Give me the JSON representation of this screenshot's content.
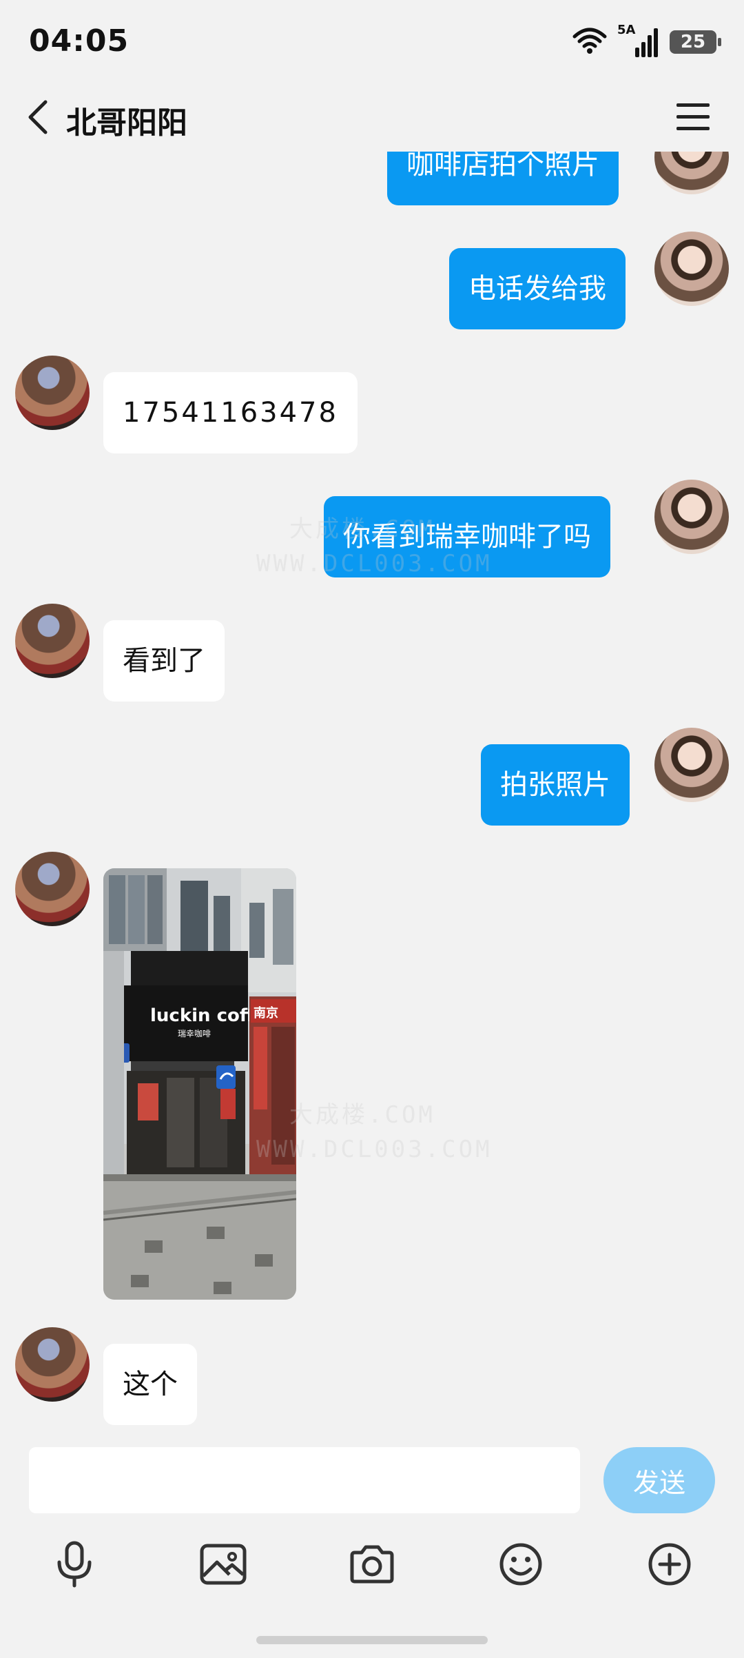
{
  "status_bar": {
    "time": "04:05",
    "network": "5A",
    "battery": "25"
  },
  "header": {
    "title": "北哥阳阳"
  },
  "messages": [
    {
      "side": "out",
      "type": "text",
      "text": "咖啡店拍个照片"
    },
    {
      "side": "out",
      "type": "text",
      "text": "电话发给我"
    },
    {
      "side": "in",
      "type": "text",
      "text": "17541163478"
    },
    {
      "side": "out",
      "type": "text",
      "text": "你看到瑞幸咖啡了吗"
    },
    {
      "side": "in",
      "type": "text",
      "text": "看到了"
    },
    {
      "side": "out",
      "type": "text",
      "text": "拍张照片"
    },
    {
      "side": "in",
      "type": "image",
      "sign_text": "luckin coffee",
      "sign_subtext": "瑞幸咖啡",
      "side_sign": "南京"
    },
    {
      "side": "in",
      "type": "text",
      "text": "这个"
    }
  ],
  "watermark": {
    "line1": "大成楼.COM",
    "line2": "WWW.DCL003.COM"
  },
  "composer": {
    "input_value": "",
    "send_label": "发送"
  },
  "toolbar": {
    "icons": [
      "microphone-icon",
      "image-icon",
      "camera-icon",
      "emoji-icon",
      "plus-icon"
    ]
  },
  "colors": {
    "outgoing_bubble": "#0a99f2",
    "incoming_bubble": "#ffffff",
    "background": "#f2f2f2",
    "send_button": "#8dcff7"
  }
}
